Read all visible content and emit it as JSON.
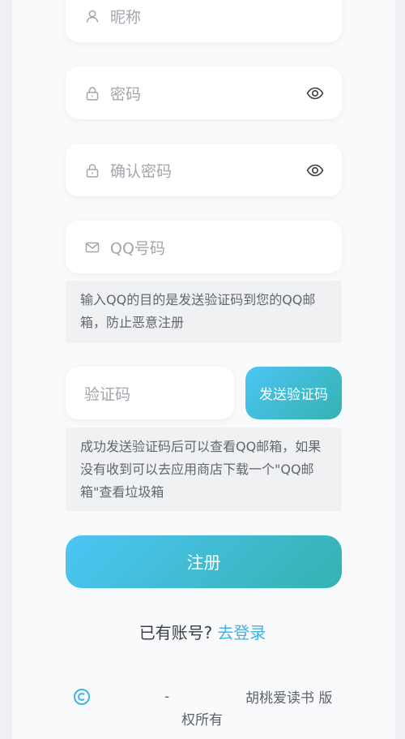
{
  "form": {
    "nickname_placeholder": "昵称",
    "password_placeholder": "密码",
    "confirm_password_placeholder": "确认密码",
    "qq_email_placeholder": "QQ号码",
    "qq_hint": "输入QQ的目的是发送验证码到您的QQ邮箱，防止恶意注册",
    "code_placeholder": "验证码",
    "send_code_label": "发送验证码",
    "code_hint": "成功发送验证码后可以查看QQ邮箱，如果没有收到可以去应用商店下载一个\"QQ邮箱\"查看垃圾箱",
    "register_label": "注册"
  },
  "login_prompt": {
    "text": "已有账号?",
    "link": "去登录"
  },
  "footer": {
    "dash": "-",
    "brand": "胡桃爱读书 版",
    "rights": "权所有"
  },
  "colors": {
    "accent_start": "#4cc5f5",
    "accent_end": "#35b2b0",
    "link": "#3fb2e8"
  },
  "icons": [
    "user-icon",
    "lock-icon",
    "eye-icon",
    "mail-icon",
    "copyright-icon"
  ]
}
